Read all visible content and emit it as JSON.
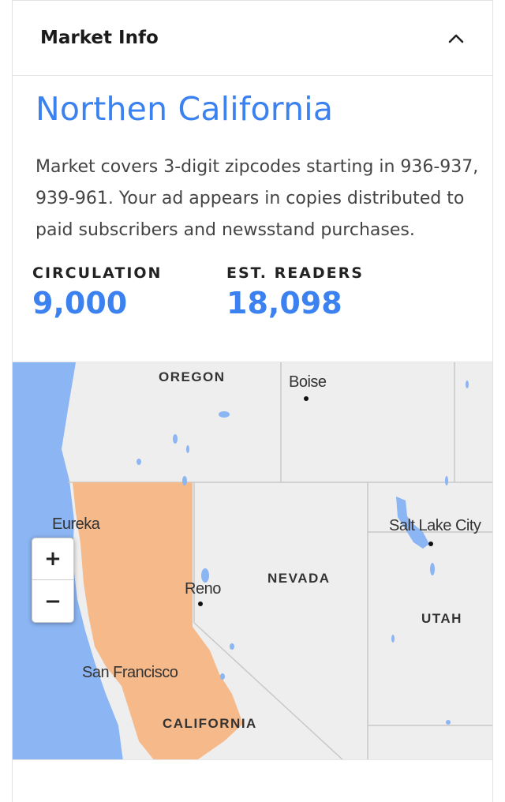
{
  "panel": {
    "title": "Market Info",
    "collapse_icon": "chevron-up-icon"
  },
  "market": {
    "name": "Northen California",
    "description": "Market covers 3-digit zipcodes starting in 936-937, 939-961. Your ad appears in copies distributed to paid subscribers and newsstand purchases.",
    "stats": [
      {
        "label": "CIRCULATION",
        "value": "9,000"
      },
      {
        "label": "EST. READERS",
        "value": "18,098"
      }
    ]
  },
  "map": {
    "states": [
      "OREGON",
      "NEVADA",
      "UTAH",
      "CALIFORNIA"
    ],
    "cities": [
      "Boise",
      "Eureka",
      "Reno",
      "Salt Lake City",
      "San Francisco"
    ],
    "zoom_in_label": "+",
    "zoom_out_label": "−",
    "colors": {
      "water": "#8bb5f3",
      "land": "#eeeeee",
      "market": "#f6b98a",
      "borders": "#c8c8c8"
    }
  },
  "colors": {
    "accent": "#3b82f0"
  }
}
